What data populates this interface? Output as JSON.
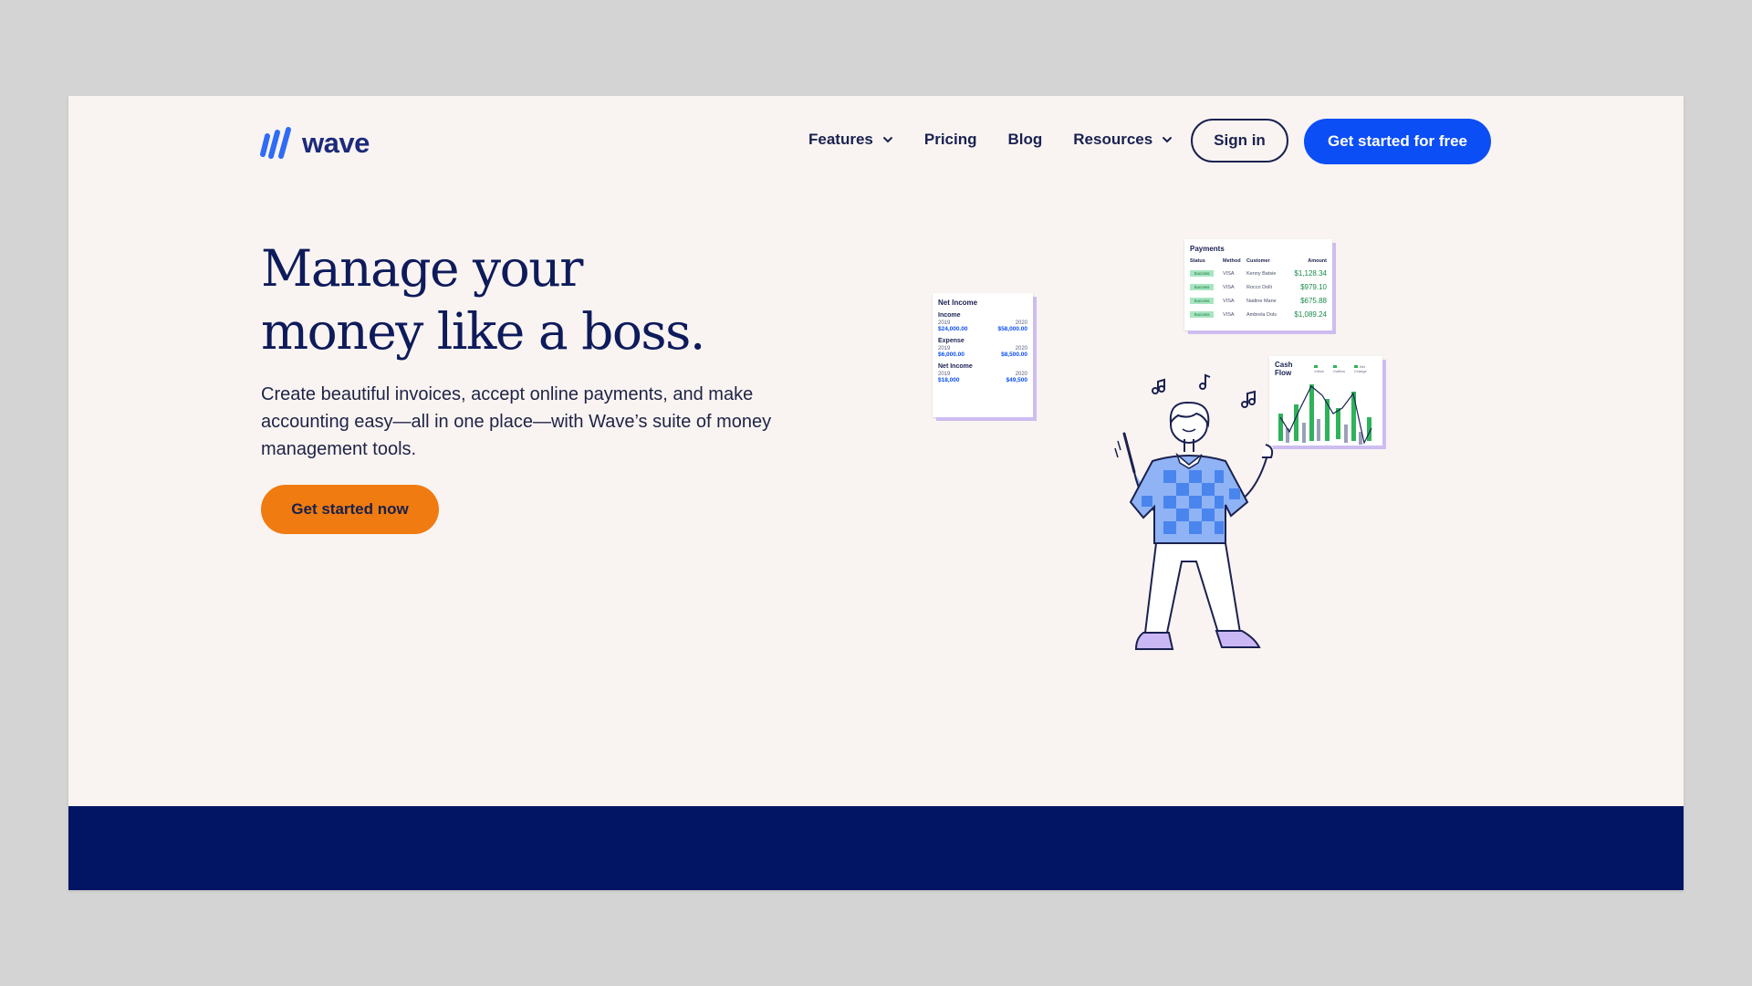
{
  "brand": {
    "name": "wave",
    "color": "#1c2a7a",
    "mark_color": "#2f6bf5"
  },
  "nav": {
    "items": [
      {
        "label": "Features",
        "has_dropdown": true
      },
      {
        "label": "Pricing",
        "has_dropdown": false
      },
      {
        "label": "Blog",
        "has_dropdown": false
      },
      {
        "label": "Resources",
        "has_dropdown": true
      }
    ],
    "signin_label": "Sign in",
    "get_started_label": "Get started for free"
  },
  "hero": {
    "title_line1": "Manage your",
    "title_line2": "money like a boss.",
    "subtitle": "Create beautiful invoices, accept online payments, and make accounting easy—all in one place—with Wave’s suite of money management tools.",
    "cta_label": "Get started now"
  },
  "illustration": {
    "net_income": {
      "title": "Net Income",
      "sections": [
        {
          "label": "Income",
          "years": [
            "2019",
            "2020"
          ],
          "values": [
            "$24,000.00",
            "$58,000.00"
          ]
        },
        {
          "label": "Expense",
          "years": [
            "2019",
            "2020"
          ],
          "values": [
            "$6,000.00",
            "$8,500.00"
          ]
        },
        {
          "label": "Net Income",
          "years": [
            "2019",
            "2020"
          ],
          "values": [
            "$18,000",
            "$49,500"
          ]
        }
      ]
    },
    "payments": {
      "title": "Payments",
      "columns": [
        "Status",
        "Method",
        "Customer",
        "Amount"
      ],
      "rows": [
        {
          "status": "Success",
          "method": "VISA",
          "customer": "Kenny Batsie",
          "amount": "$1,128.34"
        },
        {
          "status": "Success",
          "method": "VISA",
          "customer": "Rocco Dolli",
          "amount": "$979.10"
        },
        {
          "status": "Success",
          "method": "VISA",
          "customer": "Nadine Mane",
          "amount": "$675.88"
        },
        {
          "status": "Success",
          "method": "VISA",
          "customer": "Ambrela Dols",
          "amount": "$1,089.24"
        }
      ]
    },
    "cash_flow": {
      "title": "Cash Flow",
      "legend": [
        "Inflow",
        "Outflow",
        "Net Change"
      ],
      "bar_color": "#2fb35a",
      "line_color": "#1b2150"
    }
  },
  "colors": {
    "background": "#f9f4f1",
    "primary_blue": "#0c4ef5",
    "cta_orange": "#f07b10",
    "navy": "#021464"
  }
}
